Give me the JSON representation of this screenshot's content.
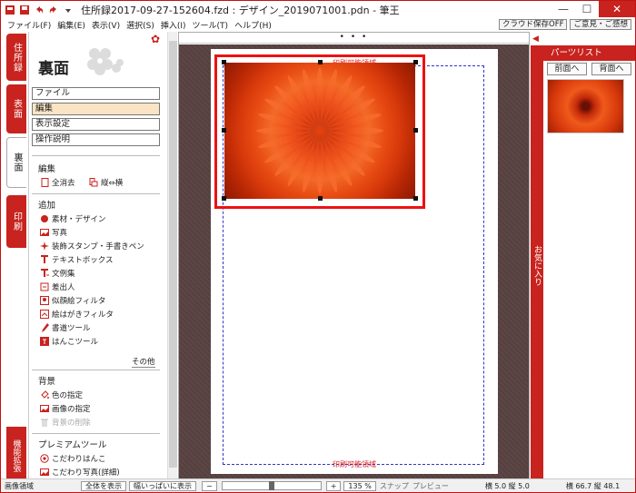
{
  "window": {
    "title": "住所録2017-09-27-152604.fzd : デザイン_2019071001.pdn - 筆王"
  },
  "menu": [
    {
      "label": "ファイル(F)"
    },
    {
      "label": "編集(E)"
    },
    {
      "label": "表示(V)"
    },
    {
      "label": "選択(S)"
    },
    {
      "label": "挿入(I)"
    },
    {
      "label": "ツール(T)"
    },
    {
      "label": "ヘルプ(H)"
    }
  ],
  "menu_buttons": {
    "cloud": "クラウド保存OFF",
    "feedback": "ご意見・ご感想"
  },
  "vtabs": {
    "address": "住所録",
    "front": "表面",
    "back": "裏面",
    "print": "印刷",
    "extra": "機能拡張"
  },
  "panel": {
    "title": "裏面",
    "modes": [
      "ファイル",
      "編集",
      "表示設定",
      "操作説明"
    ],
    "sections": {
      "edit": "編集",
      "add": "追加",
      "background": "背景",
      "premium": "プレミアムツール"
    },
    "edit_items": {
      "clear_all": "全消去",
      "orient": "縦⇔横"
    },
    "add_items": [
      "素材・デザイン",
      "写真",
      "装飾スタンプ・手書きペン",
      "テキストボックス",
      "文例集",
      "差出人",
      "似顔絵フィルタ",
      "絵はがきフィルタ",
      "書道ツール",
      "はんこツール"
    ],
    "more": "その他",
    "bg_items": [
      "色の指定",
      "画像の指定",
      "背景の削除"
    ],
    "premium_items": [
      "こだわりはんこ",
      "こだわり写真(詳細)"
    ]
  },
  "canvas": {
    "top_dots": "• • •",
    "print_area_label": "印刷可能領域"
  },
  "parts": {
    "title": "パーツリスト",
    "favorites": "お気に入り",
    "front_btn": "前面へ",
    "back_btn": "背面へ"
  },
  "status": {
    "area": "画像領域",
    "show_all": "全体を表示",
    "fit_width": "幅いっぱいに表示",
    "zoom": "135 %",
    "zoom_fraction": 0.5,
    "snap": "スナップ",
    "preview": "プレビュー",
    "size": "横 5.0 縦 5.0",
    "pos": "横 66.7 縦 48.1"
  }
}
